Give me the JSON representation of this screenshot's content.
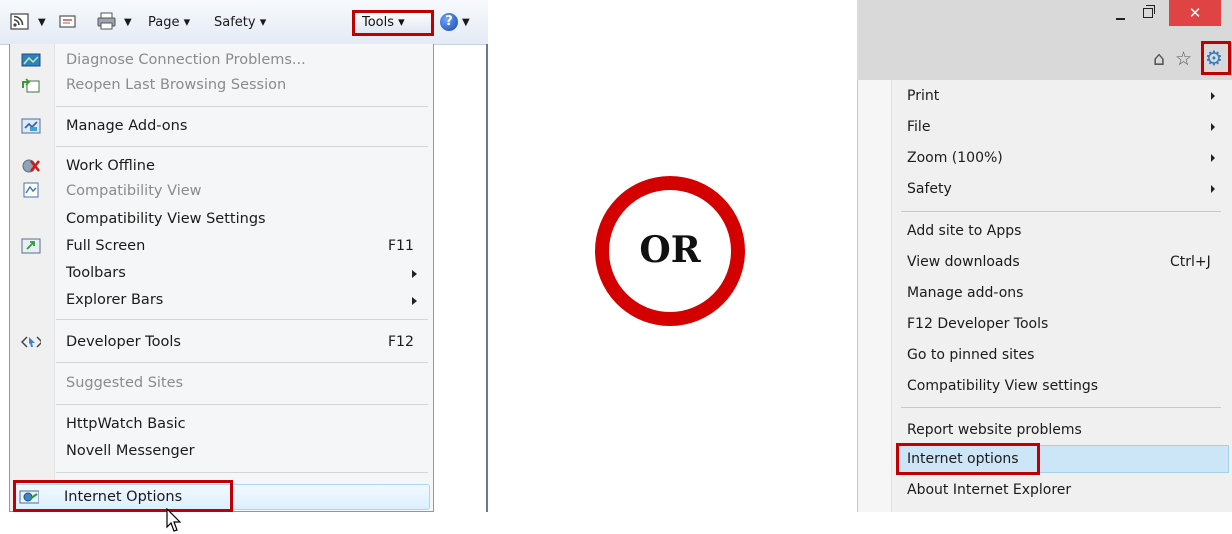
{
  "left": {
    "commandbar": {
      "page_label": "Page ▾",
      "safety_label": "Safety ▾",
      "tools_label": "Tools ▾"
    },
    "menu": [
      {
        "label": "Diagnose Connection Problems...",
        "disabled": true,
        "icon": "globe-network-icon"
      },
      {
        "label": "Reopen Last Browsing Session",
        "disabled": true,
        "icon": "reopen-session-icon"
      },
      {
        "label": "Manage Add-ons",
        "disabled": false,
        "icon": "addons-icon"
      },
      {
        "label": "Work Offline",
        "disabled": false,
        "icon": "work-offline-icon"
      },
      {
        "label": "Compatibility View",
        "disabled": true,
        "icon": "compatibility-view-icon"
      },
      {
        "label": "Compatibility View Settings",
        "disabled": false
      },
      {
        "label": "Full Screen",
        "disabled": false,
        "shortcut": "F11",
        "icon": "full-screen-icon"
      },
      {
        "label": "Toolbars",
        "disabled": false,
        "submenu": true
      },
      {
        "label": "Explorer Bars",
        "disabled": false,
        "submenu": true
      },
      {
        "label": "Developer Tools",
        "disabled": false,
        "shortcut": "F12",
        "icon": "developer-tools-icon"
      },
      {
        "label": "Suggested Sites",
        "disabled": true
      },
      {
        "label": "HttpWatch Basic",
        "disabled": false
      },
      {
        "label": "Novell Messenger",
        "disabled": false
      },
      {
        "label": "Internet Options",
        "disabled": false,
        "icon": "internet-options-icon",
        "highlighted": true
      }
    ]
  },
  "or_text": "OR",
  "right": {
    "window_controls": {
      "close_glyph": "✕"
    },
    "menu": [
      {
        "label": "Print",
        "submenu": true
      },
      {
        "label": "File",
        "submenu": true
      },
      {
        "label": "Zoom (100%)",
        "submenu": true
      },
      {
        "label": "Safety",
        "submenu": true
      },
      {
        "label": "Add site to Apps"
      },
      {
        "label": "View downloads",
        "shortcut": "Ctrl+J"
      },
      {
        "label": "Manage add-ons"
      },
      {
        "label": "F12 Developer Tools"
      },
      {
        "label": "Go to pinned sites"
      },
      {
        "label": "Compatibility View settings"
      },
      {
        "label": "Report website problems"
      },
      {
        "label": "Internet options",
        "highlighted": true
      },
      {
        "label": "About Internet Explorer"
      }
    ]
  },
  "colors": {
    "highlight_red": "#c00000",
    "or_ring": "#d40000",
    "hover_blue": "#cde6f7",
    "gear_blue": "#2b7ac0",
    "close_red": "#e04343"
  }
}
